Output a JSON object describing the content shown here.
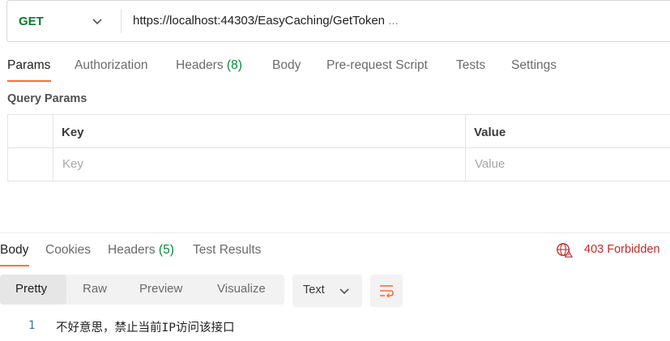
{
  "request": {
    "method": "GET",
    "url": "https://localhost:44303/EasyCaching/GetToken",
    "url_suffix": " ..."
  },
  "request_tabs": [
    {
      "label": "Params",
      "count": ""
    },
    {
      "label": "Authorization",
      "count": ""
    },
    {
      "label": "Headers",
      "count": "(8)"
    },
    {
      "label": "Body",
      "count": ""
    },
    {
      "label": "Pre-request Script",
      "count": ""
    },
    {
      "label": "Tests",
      "count": ""
    },
    {
      "label": "Settings",
      "count": ""
    }
  ],
  "query_params": {
    "title": "Query Params",
    "columns": [
      "Key",
      "Value"
    ],
    "placeholders": [
      "Key",
      "Value"
    ]
  },
  "response_tabs": [
    {
      "label": "Body",
      "count": ""
    },
    {
      "label": "Cookies",
      "count": ""
    },
    {
      "label": "Headers",
      "count": "(5)"
    },
    {
      "label": "Test Results",
      "count": ""
    }
  ],
  "status": {
    "text": "403 Forbidden",
    "color": "#c62828"
  },
  "format_tabs": [
    "Pretty",
    "Raw",
    "Preview",
    "Visualize"
  ],
  "format_selected": "Text",
  "response_body": [
    {
      "line": "1",
      "text": "不好意思，禁止当前IP访问该接口"
    }
  ],
  "colors": {
    "accent": "#ff6c37",
    "method_get": "#0a7a2f",
    "count": "#0a8a3a"
  }
}
